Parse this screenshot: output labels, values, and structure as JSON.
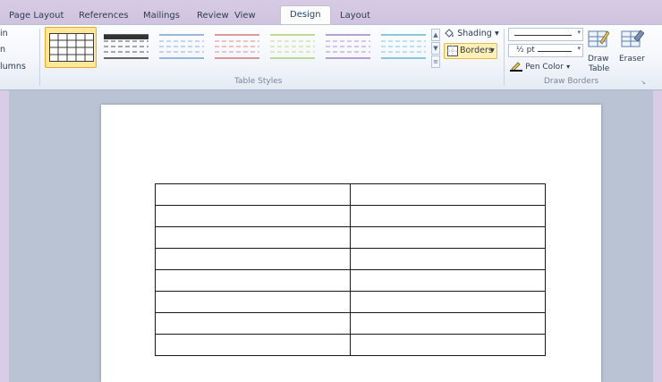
{
  "ribbon_tabs": [
    {
      "label": "Page Layout"
    },
    {
      "label": "References"
    },
    {
      "label": "Mailings"
    },
    {
      "label": "Review"
    },
    {
      "label": "View"
    },
    {
      "label": "Design",
      "active": true
    },
    {
      "label": "Layout"
    }
  ],
  "table_style_options": {
    "item1": "in",
    "item2": "n",
    "item3": "lumns"
  },
  "table_styles": {
    "group_label": "Table Styles",
    "thumbnails": [
      {
        "name": "plain-grid",
        "color": "#3a3a3a",
        "selected": true
      },
      {
        "name": "dark-lines",
        "color": "#333333"
      },
      {
        "name": "blue-lines",
        "color": "#5f8ec9"
      },
      {
        "name": "red-lines",
        "color": "#c9605c"
      },
      {
        "name": "green-lines",
        "color": "#9cc45a"
      },
      {
        "name": "purple-lines",
        "color": "#8c6bb8"
      },
      {
        "name": "teal-lines",
        "color": "#46a9c2"
      }
    ]
  },
  "shading": {
    "label": "Shading",
    "caret": "▾"
  },
  "borders": {
    "label": "Borders",
    "caret": "▾"
  },
  "draw_borders": {
    "group_label": "Draw Borders",
    "pen_weight": "½ pt",
    "pen_color_label": "Pen Color",
    "pen_color_caret": "▾",
    "draw_table_label_1": "Draw",
    "draw_table_label_2": "Table",
    "eraser_label": "Eraser"
  },
  "document_table": {
    "rows": 8,
    "columns": 2
  },
  "colors": {
    "accent_selected": "#ffe89a",
    "page_background": "#ffffff",
    "workspace": "#b9c3d3"
  }
}
